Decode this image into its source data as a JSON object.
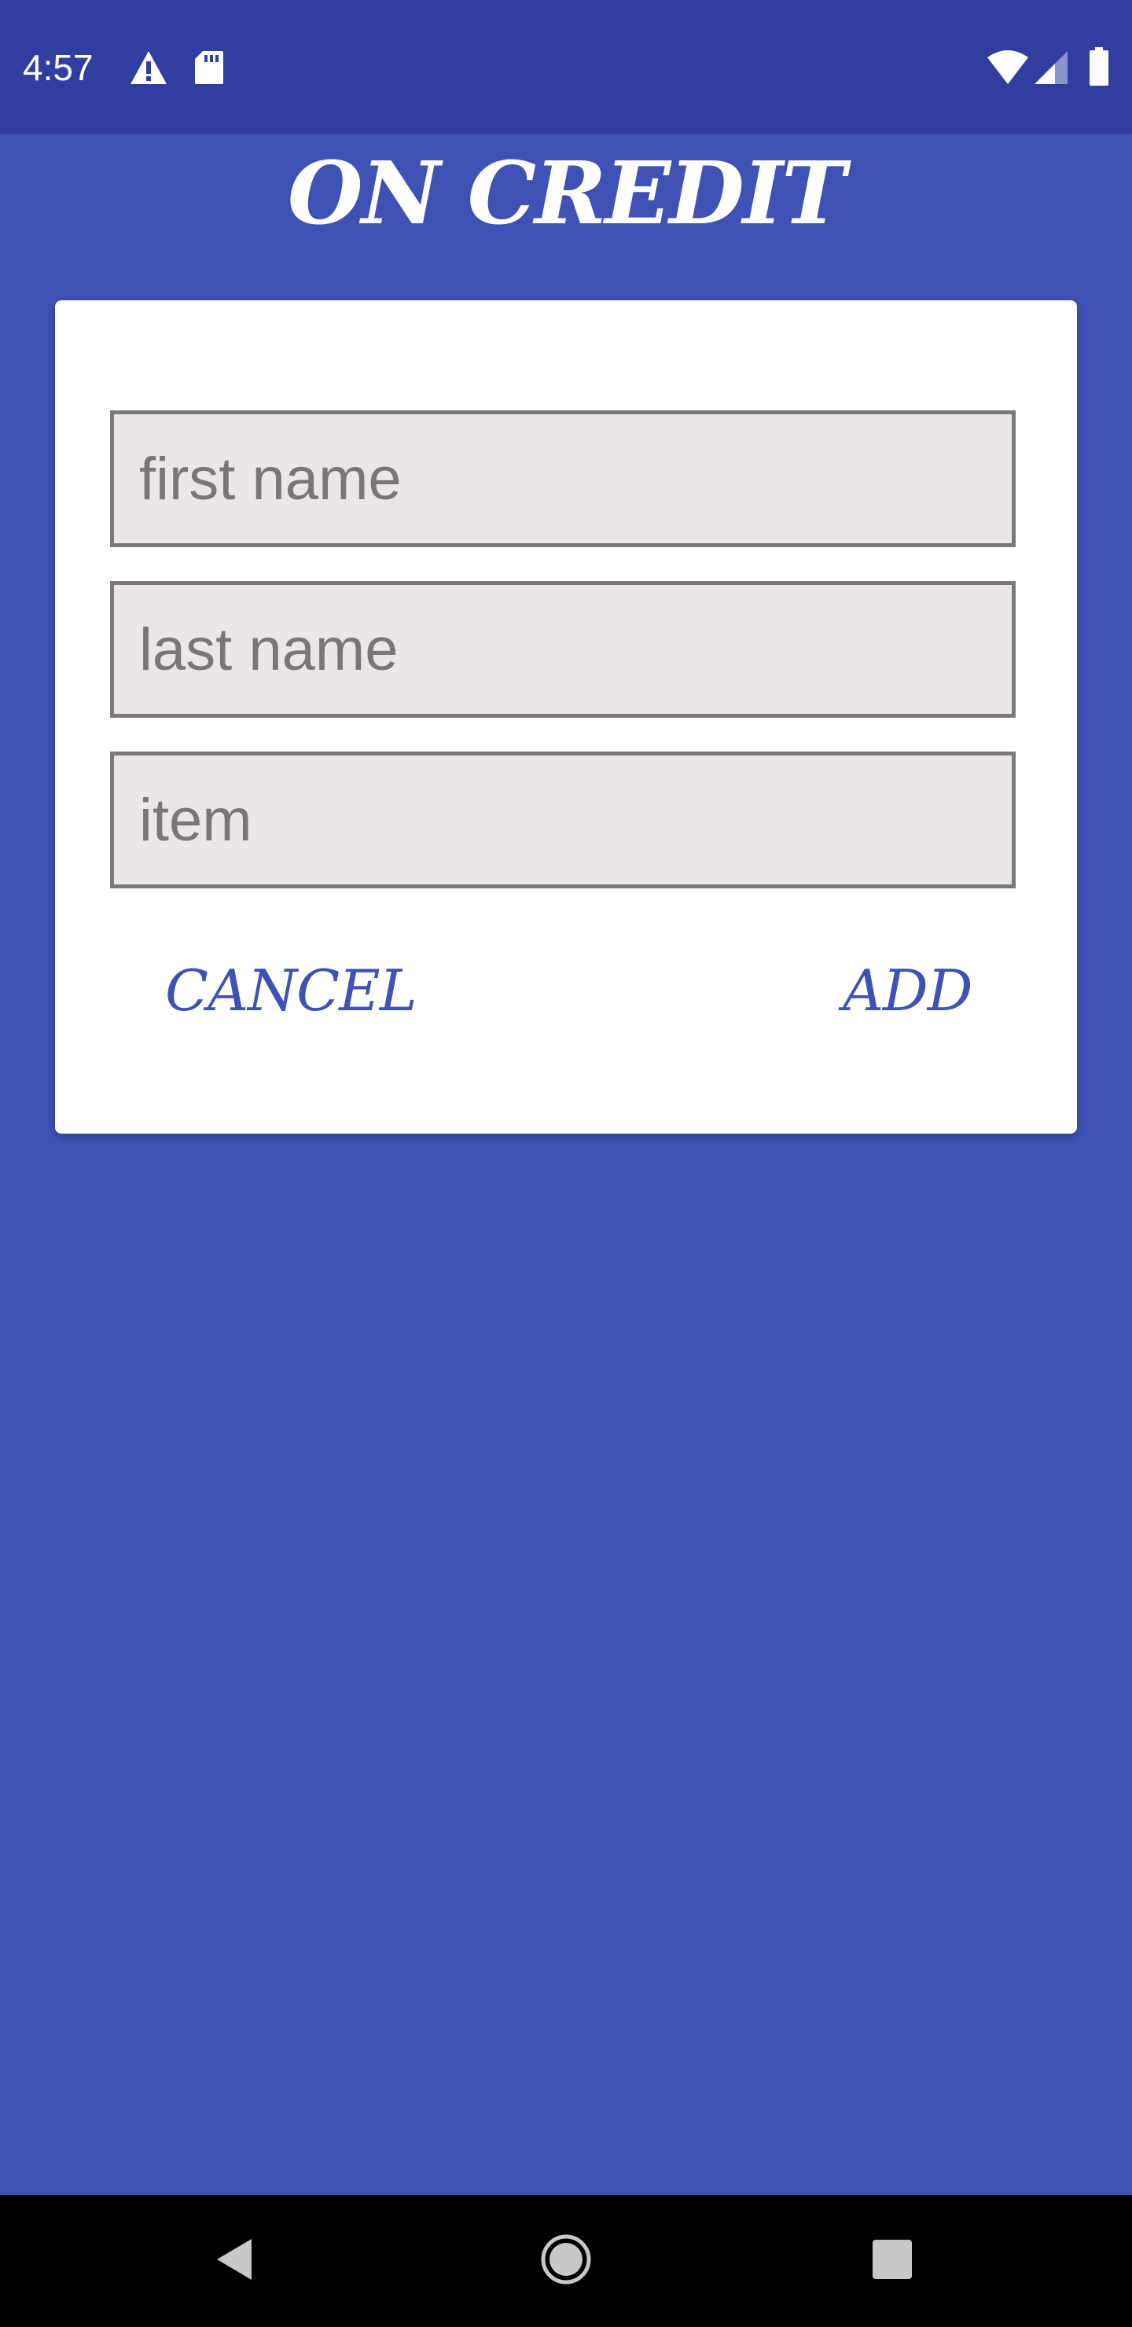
{
  "status_bar": {
    "time": "4:57",
    "icons": [
      "alert-icon",
      "sd-card-icon",
      "wifi-icon",
      "cell-signal-icon",
      "battery-icon"
    ]
  },
  "header": {
    "title": "ON CREDIT"
  },
  "form": {
    "first_name_placeholder": "first name",
    "last_name_placeholder": "last name",
    "item_placeholder": "item",
    "cancel_label": "CANCEL",
    "add_label": "ADD"
  },
  "nav_bar": {
    "icons": [
      "back-icon",
      "home-icon",
      "recents-icon"
    ]
  },
  "colors": {
    "primary": "#3f51b5",
    "primary_dark": "#303f9f",
    "field_bg": "#ece7e7",
    "field_border": "#7a7a7a"
  }
}
